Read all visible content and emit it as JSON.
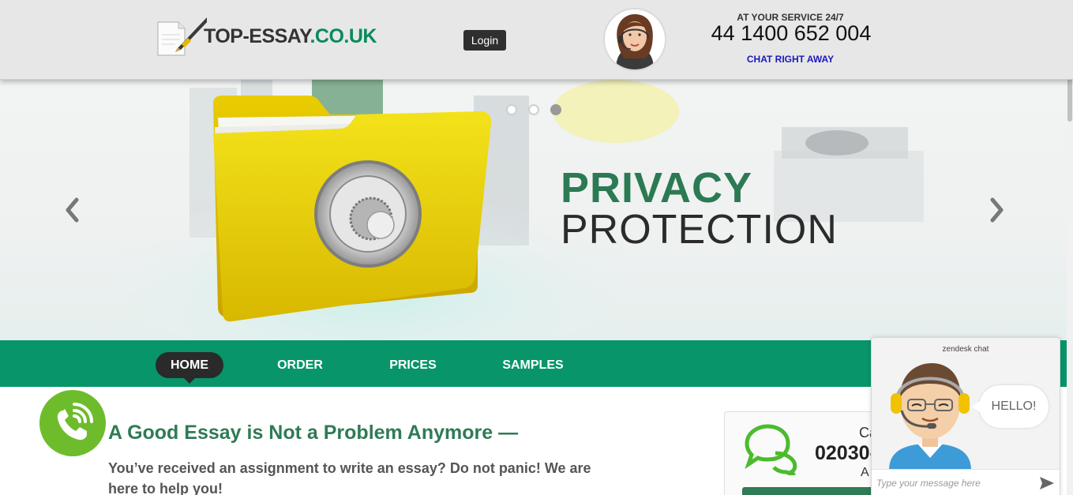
{
  "header": {
    "logo_main": "TOP-ESSAY",
    "logo_tld": ".CO.UK",
    "login_label": "Login",
    "service_label": "AT YOUR SERVICE 24/7",
    "phone": "44 1400 652 004",
    "chat_link": "CHAT RIGHT AWAY"
  },
  "slider": {
    "title_line1": "PRIVACY",
    "title_line2": "PROTECTION",
    "dots_count": 3,
    "active_dot": 3,
    "prev_icon": "chevron-left-icon",
    "next_icon": "chevron-right-icon"
  },
  "nav": {
    "items": [
      {
        "label": "HOME",
        "active": true
      },
      {
        "label": "ORDER",
        "active": false
      },
      {
        "label": "PRICES",
        "active": false
      },
      {
        "label": "SAMPLES",
        "active": false
      }
    ]
  },
  "main": {
    "headline": "A Good Essay is Not a Problem Anymore —",
    "intro": "You’ve received an assignment to write an essay? Do not panic! We are here to help you!"
  },
  "side_box": {
    "call_label": "Ca",
    "phone": "02030-",
    "avail": "A"
  },
  "chat_widget": {
    "brand": "zendesk chat",
    "greeting": "HELLO!",
    "input_placeholder": "Type your message here"
  },
  "colors": {
    "brand_green": "#079569",
    "headline_green": "#2f7b55",
    "call_green": "#6ebc2c",
    "chat_link_blue": "#1a1ab8"
  }
}
